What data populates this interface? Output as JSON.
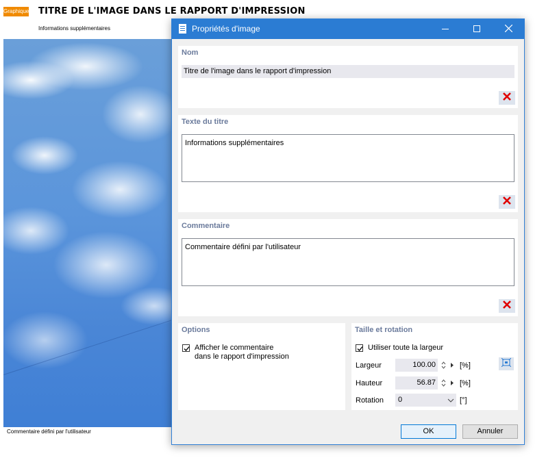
{
  "report": {
    "badge": "Graphique",
    "title": "TITRE DE L'IMAGE DANS LE RAPPORT D'IMPRESSION",
    "subtitle": "Informations supplémentaires",
    "comment": "Commentaire défini par l'utilisateur"
  },
  "dialog": {
    "title": "Propriétés d'image",
    "icons": {
      "title": "document-icon",
      "minimize": "minimize-icon",
      "maximize": "maximize-icon",
      "close": "close-icon"
    },
    "name": {
      "label": "Nom",
      "value": "Titre de l'image dans le rapport d'impression"
    },
    "title_text": {
      "label": "Texte du titre",
      "value": "Informations supplémentaires"
    },
    "comment": {
      "label": "Commentaire",
      "value": "Commentaire défini par l'utilisateur"
    },
    "options": {
      "label": "Options",
      "show_comment": {
        "checked": true,
        "line1": "Afficher le commentaire",
        "line2": "dans le rapport d'impression"
      }
    },
    "size": {
      "label": "Taille et rotation",
      "full_width": {
        "checked": true,
        "label": "Utiliser toute la largeur"
      },
      "width": {
        "label": "Largeur",
        "value": "100.00",
        "unit": "[%]"
      },
      "height": {
        "label": "Hauteur",
        "value": "56.87",
        "unit": "[%]"
      },
      "rotation": {
        "label": "Rotation",
        "value": "0",
        "unit": "[°]"
      }
    },
    "buttons": {
      "ok": "OK",
      "cancel": "Annuler"
    },
    "colors": {
      "titlebar": "#2b7cd3",
      "delete": "#e00000",
      "section_label": "#6b7b9c",
      "accent": "#f08a00"
    }
  }
}
